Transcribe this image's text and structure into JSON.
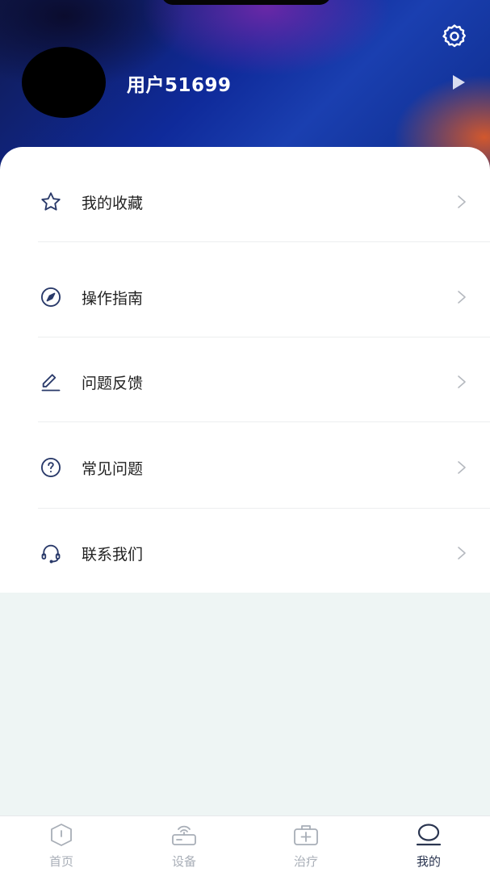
{
  "header": {
    "username": "用户51699"
  },
  "menu": {
    "items": [
      {
        "label": "我的收藏",
        "icon": "star-icon"
      },
      {
        "label": "操作指南",
        "icon": "compass-icon"
      },
      {
        "label": "问题反馈",
        "icon": "edit-icon"
      },
      {
        "label": "常见问题",
        "icon": "question-circle-icon"
      },
      {
        "label": "联系我们",
        "icon": "headset-icon"
      }
    ]
  },
  "bottom_nav": {
    "items": [
      {
        "label": "首页",
        "icon": "home-shield-icon",
        "active": false
      },
      {
        "label": "设备",
        "icon": "device-icon",
        "active": false
      },
      {
        "label": "治疗",
        "icon": "medical-kit-icon",
        "active": false
      },
      {
        "label": "我的",
        "icon": "profile-icon",
        "active": true
      }
    ]
  },
  "colors": {
    "icon_dark": "#2a3a6a",
    "chevron": "#b5b9bf",
    "nav_inactive": "#a8aeb7",
    "nav_active": "#2a3550"
  }
}
